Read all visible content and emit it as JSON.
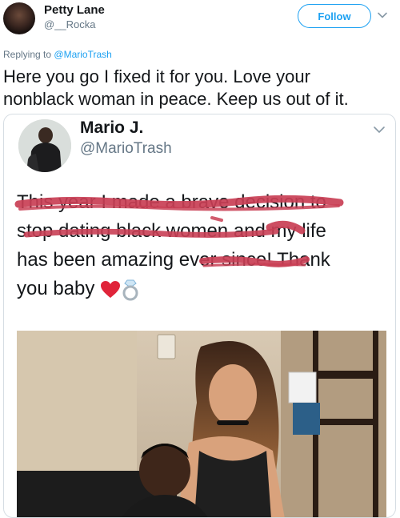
{
  "tweet": {
    "author": {
      "display_name": "Petty Lane",
      "handle": "@__Rocka"
    },
    "follow_label": "Follow",
    "reply": {
      "prefix": "Replying to",
      "mention": "@MarioTrash"
    },
    "text_line1": "Here you go I fixed it for you. Love your",
    "text_line2": "nonblack woman in peace. Keep us out of it."
  },
  "quoted": {
    "author": {
      "display_name": "Mario J.",
      "handle": "@MarioTrash"
    },
    "text": {
      "line1": "This year I made a brave decision to",
      "line2": "stop dating black women and my life",
      "line3": "has been amazing ever since! Thank",
      "line4": "you baby"
    },
    "emojis": [
      "red-heart-icon",
      "ring-icon"
    ],
    "scribble_color": "#c93f55"
  },
  "colors": {
    "accent": "#1da1f2",
    "secondary_text": "#657786",
    "border": "#d6dde3"
  }
}
